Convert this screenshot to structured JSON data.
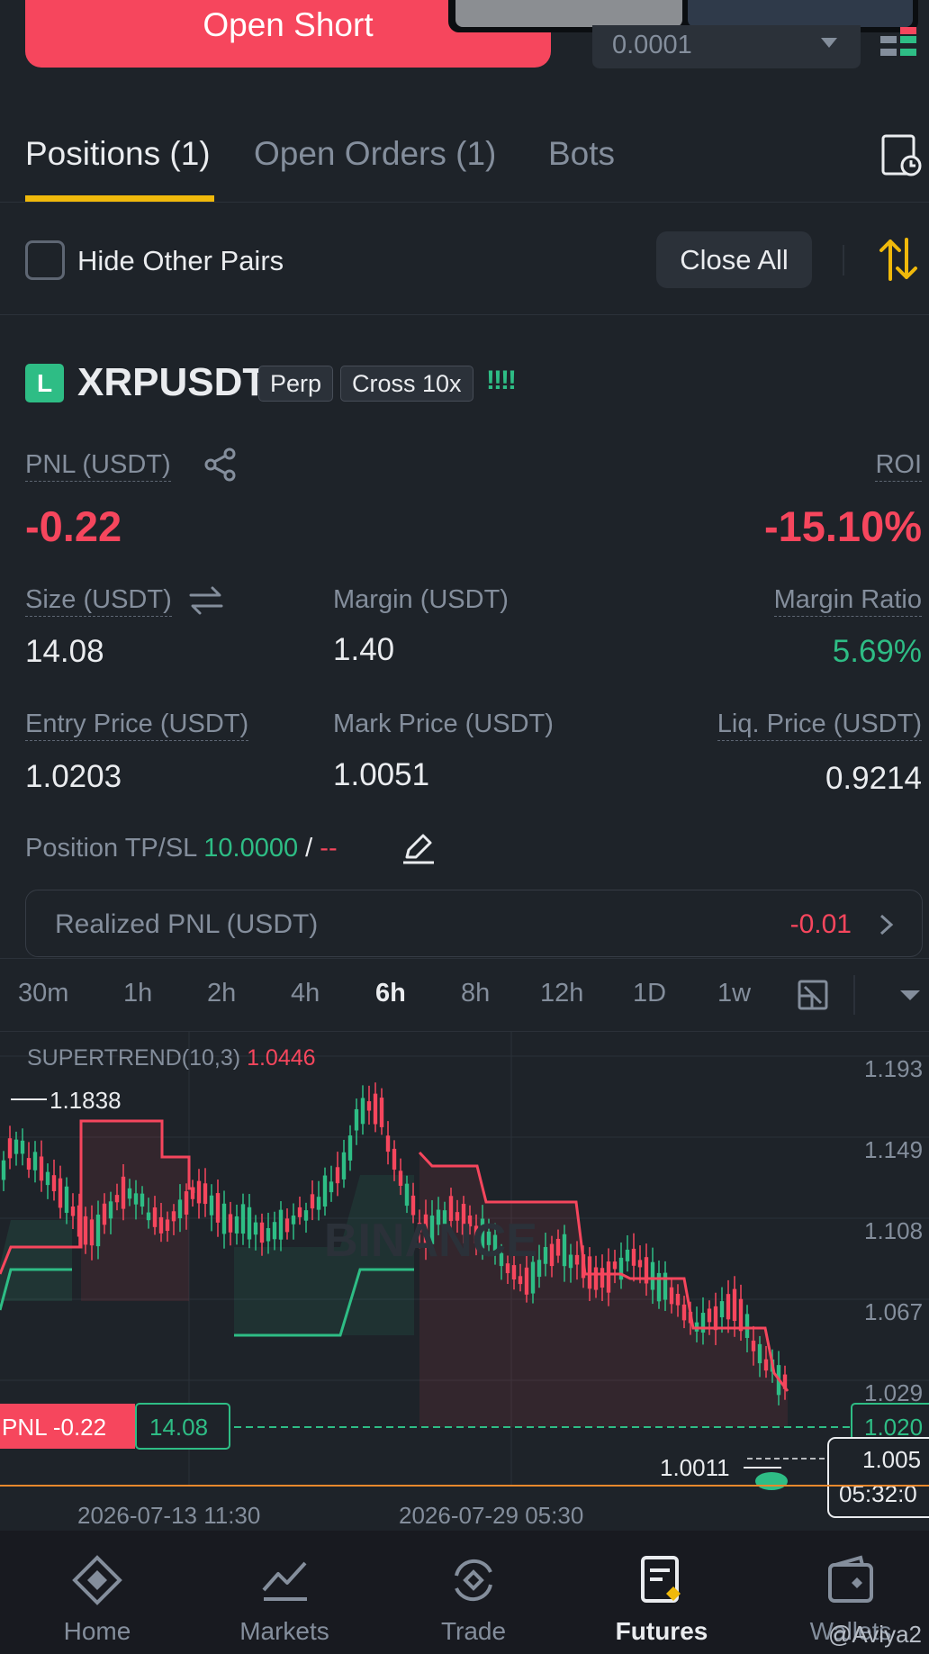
{
  "top": {
    "open_short_label": "Open Short",
    "precision_value": "0.0001"
  },
  "tabs": [
    {
      "label": "Positions (1)",
      "active": true
    },
    {
      "label": "Open Orders (1)",
      "active": false
    },
    {
      "label": "Bots",
      "active": false
    }
  ],
  "filter": {
    "hide_other_pairs_label": "Hide Other Pairs",
    "hide_other_pairs_checked": false,
    "close_all_label": "Close All"
  },
  "position": {
    "side_badge": "L",
    "symbol": "XRPUSDT",
    "tags": [
      "Perp",
      "Cross 10x"
    ],
    "signal_bars": "!!!!",
    "pnl_label": "PNL (USDT)",
    "pnl_value": "-0.22",
    "roi_label": "ROI",
    "roi_value": "-15.10%",
    "size_label": "Size (USDT)",
    "size_value": "14.08",
    "margin_label": "Margin (USDT)",
    "margin_value": "1.40",
    "margin_ratio_label": "Margin Ratio",
    "margin_ratio_value": "5.69%",
    "entry_label": "Entry Price (USDT)",
    "entry_value": "1.0203",
    "mark_label": "Mark Price (USDT)",
    "mark_value": "1.0051",
    "liq_label": "Liq. Price (USDT)",
    "liq_value": "0.9214",
    "tpsl_label": "Position TP/SL",
    "tp_value": "10.0000",
    "tpsl_sep": "/",
    "sl_value": "--",
    "realized_label": "Realized PNL (USDT)",
    "realized_value": "-0.01"
  },
  "chart": {
    "timeframes": [
      "30m",
      "1h",
      "2h",
      "4h",
      "6h",
      "8h",
      "12h",
      "1D",
      "1w"
    ],
    "active_timeframe": "6h",
    "indicator_label": "SUPERTREND(10,3)",
    "indicator_value": "1.0446",
    "watermark": "BINANCE",
    "high_label": "1.1838",
    "low_label": "1.0011",
    "price_axis": [
      "1.193",
      "1.149",
      "1.108",
      "1.067",
      "1.029"
    ],
    "pnl_tag": "PNL -0.22",
    "size_tag": "14.08",
    "entry_tag": "1.020",
    "mark_tag": "1.005",
    "countdown": "05:32:0",
    "x_labels": [
      "2026-07-13 11:30",
      "2026-07-29 05:30"
    ],
    "colors": {
      "up": "#2ebd85",
      "down": "#f6465d",
      "bg": "#1e2329"
    }
  },
  "nav": [
    {
      "label": "Home",
      "icon": "home-icon",
      "active": false
    },
    {
      "label": "Markets",
      "icon": "markets-icon",
      "active": false
    },
    {
      "label": "Trade",
      "icon": "trade-icon",
      "active": false
    },
    {
      "label": "Futures",
      "icon": "futures-icon",
      "active": true
    },
    {
      "label": "Wallets",
      "icon": "wallet-icon",
      "active": false
    }
  ],
  "watermark_user": "@Aviya2"
}
